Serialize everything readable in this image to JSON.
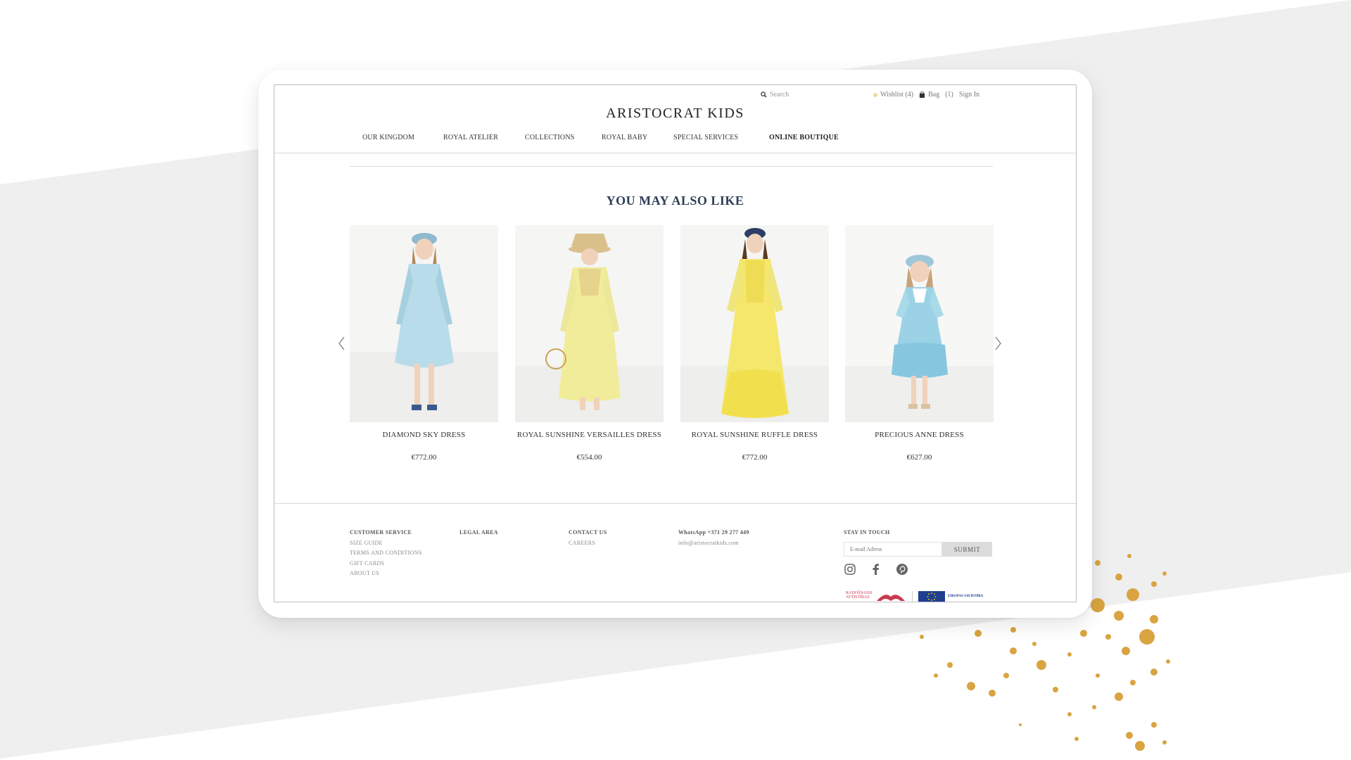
{
  "header": {
    "search_placeholder": "Search",
    "wishlist": "Wishlist (4)",
    "bag": "Bag",
    "bag_count": "(1)",
    "sign_in": "Sign In",
    "logo": "ARISTOCRAT KIDS",
    "nav": [
      "OUR KINGDOM",
      "ROYAL ATELIER",
      "COLLECTIONS",
      "ROYAL BABY",
      "SPECIAL SERVICES",
      "ONLINE BOUTIQUE"
    ]
  },
  "main": {
    "section_title": "YOU MAY ALSO LIKE",
    "products": [
      {
        "name": "DIAMOND SKY DRESS",
        "price": "€772.00",
        "dress_color": "#b8dce9"
      },
      {
        "name": "ROYAL SUNSHINE VERSAILLES DRESS",
        "price": "€554.00",
        "dress_color": "#f1ec9a"
      },
      {
        "name": "ROYAL SUNSHINE RUFFLE DRESS",
        "price": "€772.00",
        "dress_color": "#f4e76c"
      },
      {
        "name": "PRECIOUS ANNE DRESS",
        "price": "€627.00",
        "dress_color": "#9bd2e6"
      }
    ]
  },
  "footer": {
    "customer_service": {
      "heading": "CUSTOMER SERVICE",
      "links": [
        "SIZE GUIDE",
        "TERMS AND CONDITIONS",
        "GIFT CARDS",
        "ABOUT US"
      ]
    },
    "legal": {
      "heading": "LEGAL AREA"
    },
    "contact": {
      "heading": "CONTACT US",
      "links": [
        "CAREERS"
      ]
    },
    "whatsapp": "WhatsApp +371 29 277 449",
    "email": "info@aristocratkids.com",
    "newsletter": {
      "heading": "STAY IN TOUCH",
      "placeholder": "E-mail Adress",
      "submit": "SUBMIT"
    },
    "social": [
      "instagram-icon",
      "facebook-icon",
      "pinterest-icon"
    ],
    "partner_logos": {
      "lv": "RADOŠŅAISS ATTĪSTĪBAS",
      "eu": "EIROPAS SAVIENĪBA"
    }
  },
  "colors": {
    "title": "#2e3f57",
    "accent_gold": "#d9a441",
    "page_gray": "#efeff0"
  }
}
